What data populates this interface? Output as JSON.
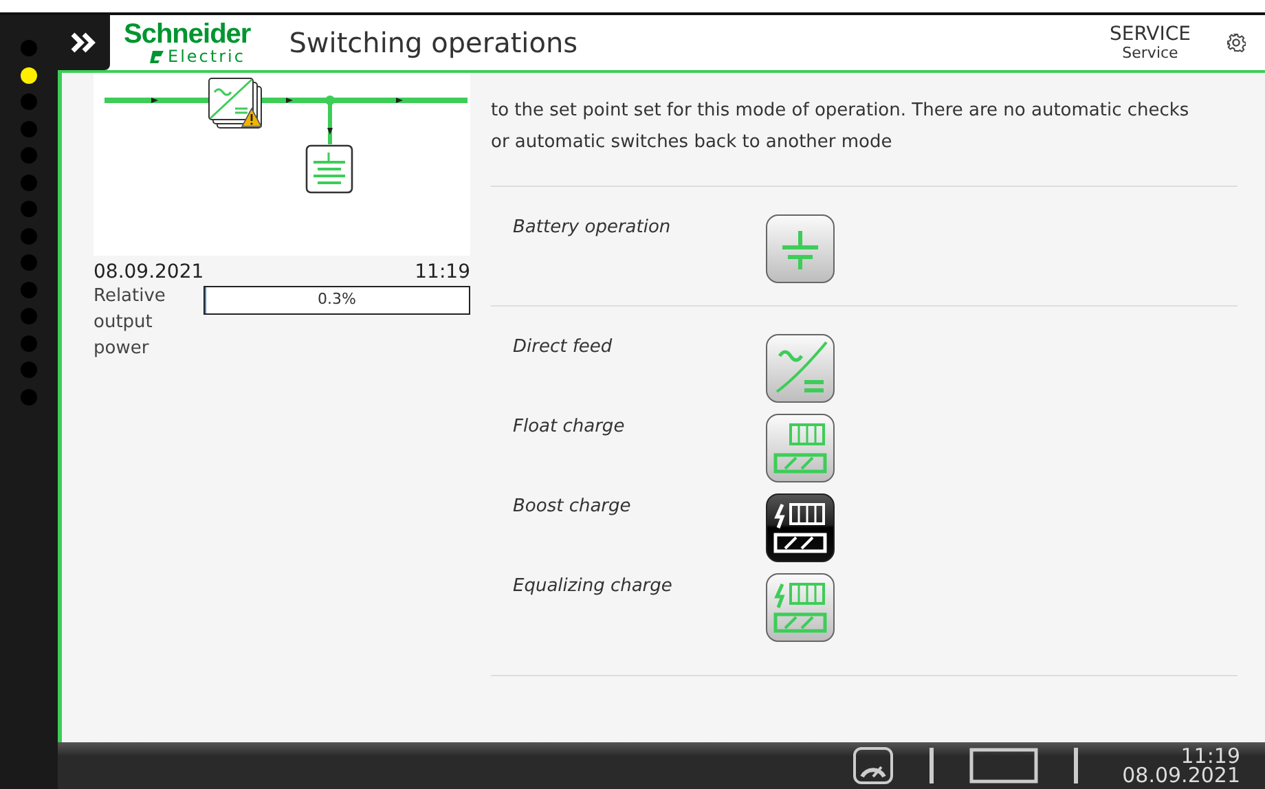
{
  "header": {
    "brand": "Schneider",
    "brand_sub": "Electric",
    "title": "Switching operations",
    "user_role": "SERVICE",
    "user_name": "Service"
  },
  "page_dots": [
    {
      "selected": false
    },
    {
      "selected": true
    },
    {
      "selected": false
    },
    {
      "selected": false
    },
    {
      "selected": false
    },
    {
      "selected": false
    },
    {
      "selected": false
    },
    {
      "selected": false
    },
    {
      "selected": false
    },
    {
      "selected": false
    },
    {
      "selected": false
    },
    {
      "selected": false
    },
    {
      "selected": false
    },
    {
      "selected": false
    }
  ],
  "status": {
    "date": "08.09.2021",
    "time": "11:19",
    "power_label": "Relative output power",
    "power_reading": "0.3%",
    "level": 0.003
  },
  "notice": "to the set point set for this mode of operation.   There are no automatic checks or automatic switches back to another mode",
  "mode_groups": [
    [
      {
        "label": "Battery operation",
        "kind": "battery",
        "selected": false
      }
    ],
    [
      {
        "label": "Direct feed",
        "kind": "direct",
        "selected": false
      },
      {
        "label": "Float charge",
        "kind": "float",
        "selected": false
      },
      {
        "label": "Boost charge",
        "kind": "boost",
        "selected": true
      },
      {
        "label": "Equalizing charge",
        "kind": "equalize",
        "selected": false
      }
    ]
  ],
  "footer": {
    "time": "11:19",
    "date": "08.09.2021"
  }
}
